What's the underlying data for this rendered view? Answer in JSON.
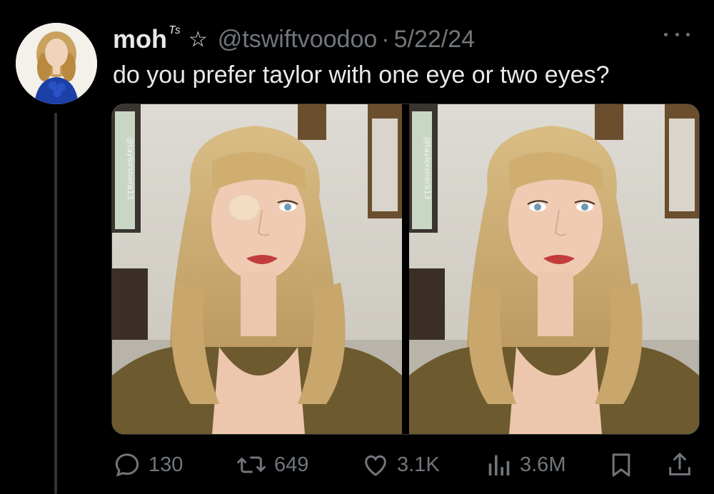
{
  "tweet": {
    "display_name": "moh",
    "name_suffix": "ᵀˢ",
    "star_icon": "☆",
    "handle": "@tswiftvoodoo",
    "separator": "·",
    "date": "5/22/24",
    "text": "do you prefer taylor with one eye or two eyes?",
    "avatar_icon": "profile-photo",
    "more_icon": "more-horizontal-icon"
  },
  "media": {
    "images": [
      {
        "name": "photo-one-eye",
        "watermark": "@taylorsnera13",
        "description_icon": "edited-photo-eye-patch"
      },
      {
        "name": "photo-two-eyes",
        "watermark": "@taylorsnera13",
        "description_icon": "original-photo"
      }
    ]
  },
  "actions": {
    "replies": "130",
    "reposts": "649",
    "likes": "3.1K",
    "views": "3.6M"
  },
  "colors": {
    "background": "#000000",
    "text": "#e7e9ea",
    "secondary": "#71767b",
    "border": "#2f3336"
  }
}
